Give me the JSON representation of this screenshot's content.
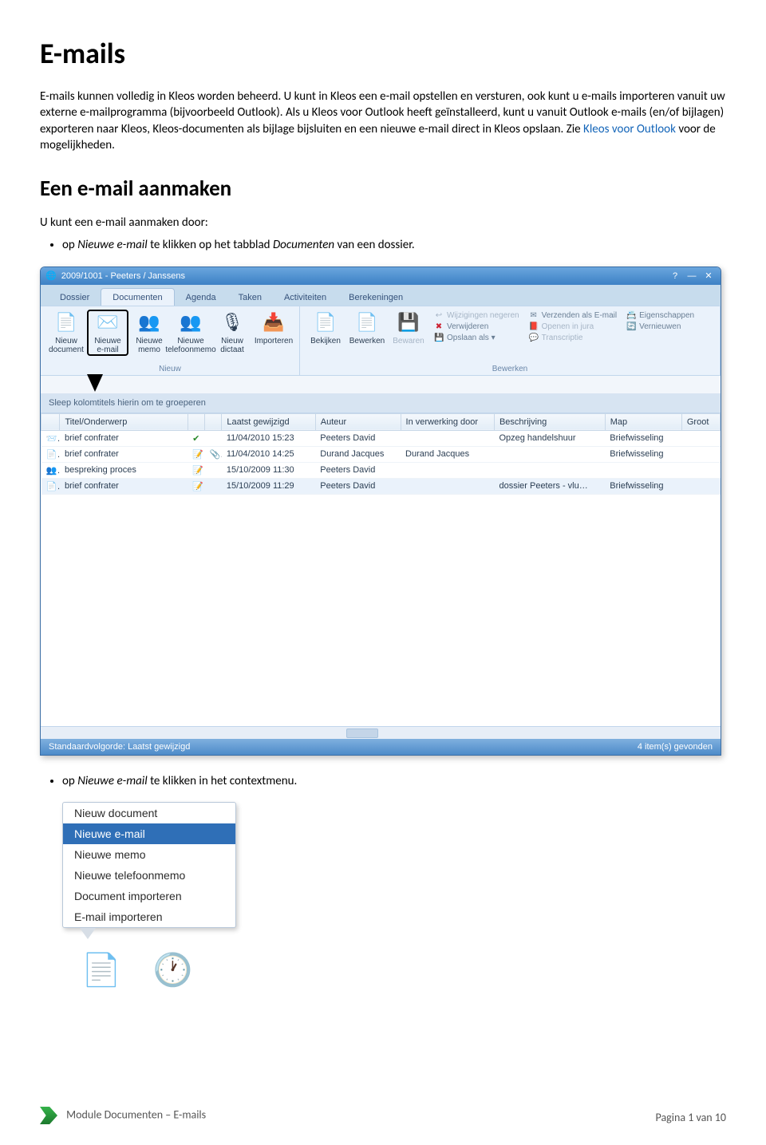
{
  "doc": {
    "title": "E-mails",
    "intro_1": "E-mails kunnen volledig in Kleos worden beheerd. U kunt in Kleos een e-mail opstellen en versturen, ook kunt u e-mails importeren vanuit uw externe e-mailprogramma (bijvoorbeeld Outlook). Als u Kleos voor Outlook heeft geïnstalleerd, kunt u vanuit Outlook e-mails (en/of bijlagen) exporteren naar Kleos, Kleos-documenten als bijlage bijsluiten en een nieuwe e-mail direct in Kleos opslaan. Zie ",
    "intro_link": "Kleos voor Outlook",
    "intro_2": " voor de mogelijkheden.",
    "section_heading": "Een e-mail aanmaken",
    "section_lead": "U kunt een e-mail aanmaken door:",
    "bullet1_a": "op ",
    "bullet1_em": "Nieuwe e-mail",
    "bullet1_b": " te klikken op het tabblad ",
    "bullet1_em2": "Documenten",
    "bullet1_c": " van een dossier.",
    "bullet2_a": "op ",
    "bullet2_em": "Nieuwe e-mail",
    "bullet2_b": " te klikken in het contextmenu."
  },
  "app": {
    "title": "2009/1001 - Peeters / Janssens",
    "tabs": [
      "Dossier",
      "Documenten",
      "Agenda",
      "Taken",
      "Activiteiten",
      "Berekeningen"
    ],
    "active_tab": 1,
    "ribbon": {
      "group1_label": "Nieuw",
      "group2_label": "Bewerken",
      "buttons_new": [
        {
          "label": "Nieuw document",
          "icon": "📄"
        },
        {
          "label": "Nieuwe e-mail",
          "icon": "✉️",
          "highlight": true
        },
        {
          "label": "Nieuwe memo",
          "icon": "👥"
        },
        {
          "label": "Nieuwe telefoonmemo",
          "icon": "👥"
        },
        {
          "label": "Nieuw dictaat",
          "icon": "🎙"
        },
        {
          "label": "Importeren",
          "icon": "📥"
        }
      ],
      "buttons_edit_big": [
        {
          "label": "Bekijken",
          "icon": "📄"
        },
        {
          "label": "Bewerken",
          "icon": "📄"
        },
        {
          "label": "Bewaren",
          "icon": "💾",
          "dim": true
        }
      ],
      "buttons_edit_small": [
        {
          "label": "Wijzigingen negeren",
          "icon": "↩",
          "dim": true
        },
        {
          "label": "Verwijderen",
          "icon": "✖",
          "color": "#c23"
        },
        {
          "label": "Opslaan als ▾",
          "icon": "💾"
        }
      ],
      "buttons_edit_small2": [
        {
          "label": "Verzenden als E-mail",
          "icon": "✉"
        },
        {
          "label": "Openen in jura",
          "icon": "📕",
          "dim": true
        },
        {
          "label": "Transcriptie",
          "icon": "💬",
          "dim": true
        }
      ],
      "buttons_edit_small3": [
        {
          "label": "Eigenschappen",
          "icon": "📇"
        },
        {
          "label": "Vernieuwen",
          "icon": "🔄"
        }
      ]
    },
    "group_hint": "Sleep kolomtitels hierin om te groeperen",
    "columns": [
      "",
      "Titel/Onderwerp",
      "",
      "",
      "Laatst gewijzigd",
      "Auteur",
      "In verwerking door",
      "Beschrijving",
      "Map",
      "Groot"
    ],
    "rows": [
      {
        "icon": "📨",
        "title": "brief confrater",
        "s1": "✔",
        "s2": "",
        "date": "11/04/2010 15:23",
        "author": "Peeters  David",
        "proc": "",
        "desc": "Opzeg handelshuur",
        "map": "Briefwisseling"
      },
      {
        "icon": "📄",
        "title": "brief confrater",
        "s1": "📝",
        "s2": "📎",
        "date": "11/04/2010 14:25",
        "author": "Durand  Jacques",
        "proc": "Durand  Jacques",
        "desc": "",
        "map": "Briefwisseling"
      },
      {
        "icon": "👥",
        "title": "bespreking proces",
        "s1": "📝",
        "s2": "",
        "date": "15/10/2009 11:30",
        "author": "Peeters  David",
        "proc": "",
        "desc": "",
        "map": ""
      },
      {
        "icon": "📄",
        "title": "brief confrater",
        "s1": "📝",
        "s2": "",
        "date": "15/10/2009 11:29",
        "author": "Peeters  David",
        "proc": "",
        "desc": "dossier Peeters - vlu…",
        "map": "Briefwisseling"
      }
    ],
    "status_left": "Standaardvolgorde: Laatst gewijzigd",
    "status_right": "4 item(s) gevonden"
  },
  "context_menu": {
    "items": [
      "Nieuw document",
      "Nieuwe e-mail",
      "Nieuwe memo",
      "Nieuwe telefoonmemo",
      "Document importeren",
      "E-mail importeren"
    ],
    "selected": 1
  },
  "footer": {
    "left": "Module Documenten – E-mails",
    "right": "Pagina 1 van 10"
  }
}
